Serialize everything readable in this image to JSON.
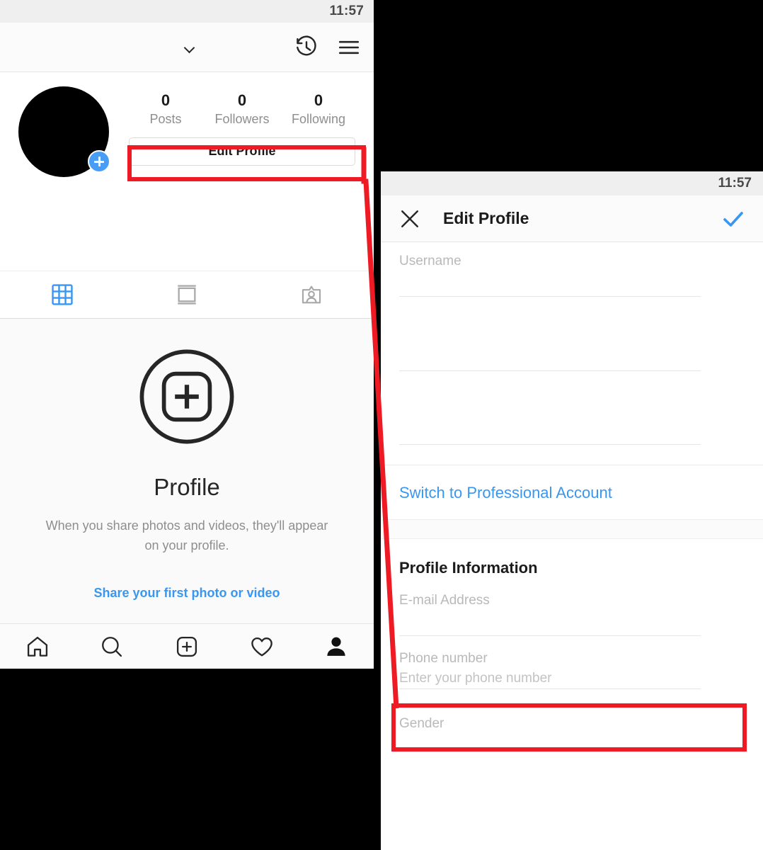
{
  "left_phone": {
    "status_bar": {
      "time": "11:57"
    },
    "app_bar": {
      "username": "",
      "dropdown_icon": "chevron-down-icon",
      "history_icon": "clock-history-icon",
      "menu_icon": "hamburger-menu-icon"
    },
    "profile": {
      "avatar": "profile-avatar",
      "add_badge": "add-story-plus-badge",
      "stats": [
        {
          "value": "0",
          "label": "Posts"
        },
        {
          "value": "0",
          "label": "Followers"
        },
        {
          "value": "0",
          "label": "Following"
        }
      ],
      "edit_profile_label": "Edit Profile"
    },
    "tabs": [
      {
        "name": "grid-tab",
        "icon": "grid-icon",
        "active": true
      },
      {
        "name": "reels-tab",
        "icon": "reels-icon",
        "active": false
      },
      {
        "name": "tagged-tab",
        "icon": "tagged-person-icon",
        "active": false
      }
    ],
    "empty_state": {
      "icon": "add-photo-circle-icon",
      "title": "Profile",
      "description": "When you share photos and videos, they'll appear on your profile.",
      "link": "Share your first photo or video"
    },
    "bottom_nav": [
      {
        "name": "home",
        "icon": "home-icon"
      },
      {
        "name": "search",
        "icon": "search-icon"
      },
      {
        "name": "create",
        "icon": "plus-square-icon"
      },
      {
        "name": "activity",
        "icon": "heart-icon"
      },
      {
        "name": "profile",
        "icon": "person-icon"
      }
    ]
  },
  "right_phone": {
    "status_bar": {
      "time": "11:57"
    },
    "app_bar": {
      "close_icon": "close-x-icon",
      "title": "Edit Profile",
      "confirm_icon": "checkmark-icon"
    },
    "fields": [
      {
        "label": "Username",
        "value": "",
        "placeholder": ""
      },
      {
        "label": "",
        "value": "",
        "placeholder": ""
      },
      {
        "label": "",
        "value": "",
        "placeholder": ""
      }
    ],
    "professional_link": "Switch to Professional Account",
    "profile_information": {
      "title": "Profile Information",
      "fields": [
        {
          "label": "E-mail Address",
          "placeholder": ""
        },
        {
          "label": "Phone number",
          "placeholder": "Enter your phone number"
        },
        {
          "label": "Gender",
          "placeholder": ""
        }
      ]
    }
  },
  "annotations": {
    "highlight_color": "#ee1b24",
    "boxes": [
      {
        "name": "edit-profile-highlight",
        "target": "Edit Profile"
      },
      {
        "name": "phone-number-highlight",
        "target": "Phone number"
      }
    ],
    "connector": {
      "name": "annotation-arrow-line",
      "from": "Edit Profile",
      "to": "Phone number"
    }
  },
  "colors": {
    "accent_blue": "#3897f0",
    "annotation_red": "#ee1b24",
    "text_primary": "#1b1b1b",
    "text_muted": "#8e8e8e"
  }
}
